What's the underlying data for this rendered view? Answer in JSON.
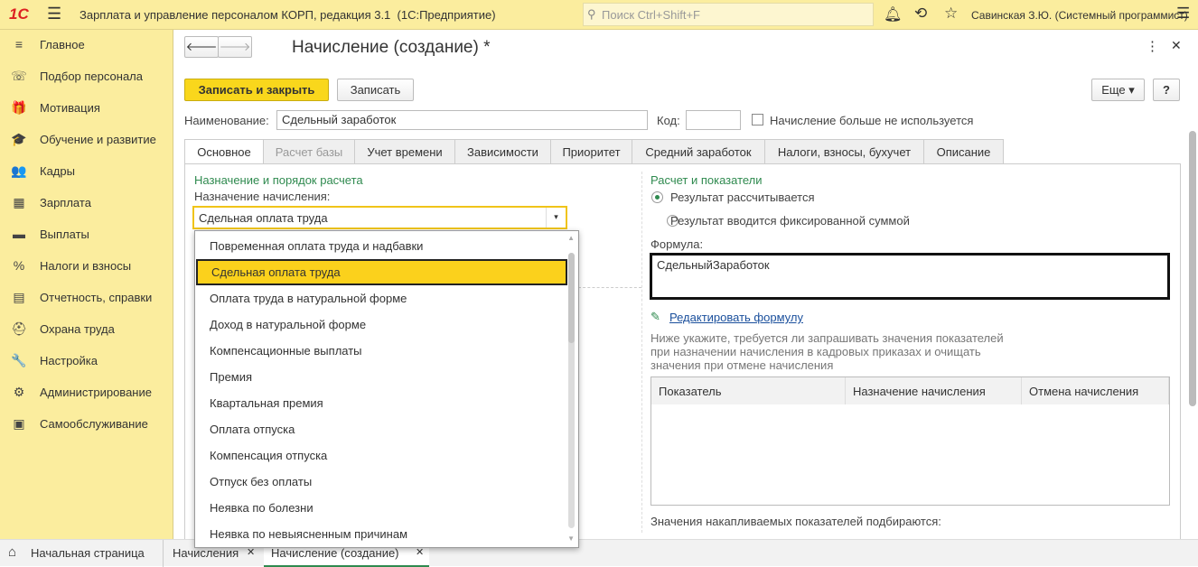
{
  "app": {
    "title": "Зарплата и управление персоналом КОРП, редакция 3.1  (1С:Предприятие)",
    "search_placeholder": "Поиск Ctrl+Shift+F",
    "user": "Савинская З.Ю. (Системный программист)"
  },
  "sidebar": {
    "items": [
      {
        "label": "Главное",
        "icon": "≡"
      },
      {
        "label": "Подбор персонала",
        "icon": "☏"
      },
      {
        "label": "Мотивация",
        "icon": "🎁"
      },
      {
        "label": "Обучение и развитие",
        "icon": "🎓"
      },
      {
        "label": "Кадры",
        "icon": "👥"
      },
      {
        "label": "Зарплата",
        "icon": "▦"
      },
      {
        "label": "Выплаты",
        "icon": "▬"
      },
      {
        "label": "Налоги и взносы",
        "icon": "%"
      },
      {
        "label": "Отчетность, справки",
        "icon": "▤"
      },
      {
        "label": "Охрана труда",
        "icon": "⛑"
      },
      {
        "label": "Настройка",
        "icon": "🔧"
      },
      {
        "label": "Администрирование",
        "icon": "⚙"
      },
      {
        "label": "Самообслуживание",
        "icon": "▣"
      }
    ]
  },
  "form": {
    "title": "Начисление (создание) *",
    "save_close": "Записать и закрыть",
    "save": "Записать",
    "more": "Еще",
    "help": "?",
    "name_label": "Наименование:",
    "name_value": "Сдельный заработок",
    "code_label": "Код:",
    "code_value": "",
    "unused_label": "Начисление больше не используется",
    "tabs": [
      "Основное",
      "Расчет базы",
      "Учет времени",
      "Зависимости",
      "Приоритет",
      "Средний заработок",
      "Налоги, взносы, бухучет",
      "Описание"
    ],
    "left": {
      "section": "Назначение и порядок расчета",
      "purpose_label": "Назначение начисления:",
      "purpose_value": "Сдельная оплата труда"
    },
    "right": {
      "section": "Расчет и показатели",
      "radio1": "Результат рассчитывается",
      "radio2": "Результат вводится фиксированной суммой",
      "formula_label": "Формула:",
      "formula_value": "СдельныйЗаработок",
      "edit_formula": "Редактировать формулу",
      "hint": "Ниже укажите, требуется ли запрашивать значения показателей при назначении начисления в кадровых приказах и очищать значения при отмене начисления",
      "columns": [
        "Показатель",
        "Назначение начисления",
        "Отмена начисления"
      ],
      "accum_note": "Значения накапливаемых показателей подбираются:"
    }
  },
  "dropdown": {
    "items": [
      "Повременная оплата труда и надбавки",
      "Сдельная оплата труда",
      "Оплата труда в натуральной форме",
      "Доход в натуральной форме",
      "Компенсационные выплаты",
      "Премия",
      "Квартальная премия",
      "Оплата отпуска",
      "Компенсация отпуска",
      "Отпуск без оплаты",
      "Неявка по болезни",
      "Неявка по невыясненным причинам"
    ],
    "selected": 1
  },
  "bottom_tabs": [
    "Начальная страница",
    "Начисления",
    "Начисление (создание)"
  ]
}
